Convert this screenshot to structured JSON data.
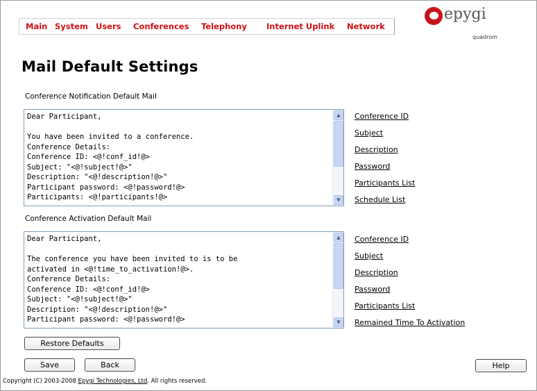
{
  "nav": {
    "items": [
      "Main",
      "System",
      "Users",
      "Conferences",
      "Telephony",
      "Internet Uplink",
      "Network"
    ]
  },
  "logo": {
    "brand": "epygi",
    "sub": "quadrom"
  },
  "page": {
    "title": "Mail Default Settings"
  },
  "notification": {
    "label": "Conference Notification Default Mail",
    "text": "Dear Participant,\n\nYou have been invited to a conference.\nConference Details:\nConference ID: <@!conf_id!@>\nSubject: \"<@!subject!@>\"\nDescription: \"<@!description!@>\"\nParticipant password: <@!password!@>\nParticipants: <@!participants!@>",
    "links": [
      "Conference ID",
      "Subject",
      "Description",
      "Password",
      "Participants List",
      "Schedule List"
    ]
  },
  "activation": {
    "label": "Conference Activation Default Mail",
    "text": "Dear Participant,\n\nThe conference you have been invited to is to be\nactivated in <@!time_to_activation!@>.\nConference Details:\nConference ID: <@!conf_id!@>\nSubject: \"<@!subject!@>\"\nDescription: \"<@!description!@>\"\nParticipant password: <@!password!@>",
    "links": [
      "Conference ID",
      "Subject",
      "Description",
      "Password",
      "Participants List",
      "Remained Time To Activation"
    ]
  },
  "buttons": {
    "restore": "Restore Defaults",
    "save": "Save",
    "back": "Back",
    "help": "Help"
  },
  "footer": {
    "prefix": "Copyright (C) 2003-2008 ",
    "company": "Epygi Technologies, Ltd",
    "suffix": ". All rights reserved."
  }
}
